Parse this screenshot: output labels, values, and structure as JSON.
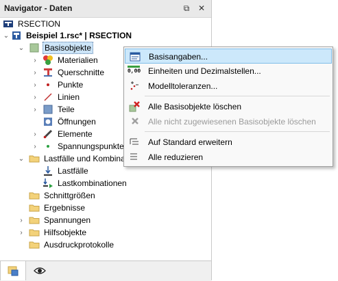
{
  "window": {
    "title": "Navigator - Daten",
    "pin_glyph": "⧉",
    "close_glyph": "✕"
  },
  "tree": {
    "root_label": "RSECTION",
    "model_label": "Beispiel 1.rsc* | RSECTION",
    "items": {
      "basisobjekte": "Basisobjekte",
      "materialien": "Materialien",
      "querschnitte": "Querschnitte",
      "punkte": "Punkte",
      "linien": "Linien",
      "teile": "Teile",
      "oeffnungen": "Öffnungen",
      "elemente": "Elemente",
      "spannungspunkte": "Spannungspunkte",
      "lastfaelle_und_kombinationen": "Lastfälle und Kombinati",
      "lastfaelle": "Lastfälle",
      "lastkombinationen": "Lastkombinationen",
      "schnittgroessen": "Schnittgrößen",
      "ergebnisse": "Ergebnisse",
      "spannungen": "Spannungen",
      "hilfsobjekte": "Hilfsobjekte",
      "ausdruckprotokolle": "Ausdruckprotokolle"
    }
  },
  "context_menu": {
    "basisangaben": "Basisangaben...",
    "einheiten": "Einheiten und Dezimalstellen...",
    "modelltoleranzen": "Modelltoleranzen...",
    "alle_loeschen": "Alle Basisobjekte löschen",
    "nicht_zugewiesene_loeschen": "Alle nicht zugewiesenen Basisobjekte löschen",
    "auf_standard_erweitern": "Auf Standard erweitern",
    "alle_reduzieren": "Alle reduzieren",
    "units_icon_text": "0,00"
  },
  "colors": {
    "highlight": "#cce8fb",
    "selection": "#cce4f7",
    "folder": "#f3d27a"
  }
}
